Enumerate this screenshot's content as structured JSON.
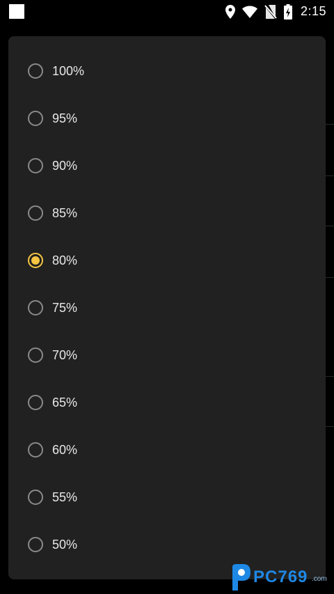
{
  "status_bar": {
    "time": "2:15",
    "icons": [
      "location-icon",
      "wifi-icon",
      "no-sim-icon",
      "battery-charging-icon"
    ]
  },
  "dialog": {
    "selected": "80%",
    "options": [
      "100%",
      "95%",
      "90%",
      "85%",
      "80%",
      "75%",
      "70%",
      "65%",
      "60%",
      "55%",
      "50%"
    ]
  },
  "accent_color": "#f5c542",
  "watermark": {
    "text": "PC769",
    "sub": ".com"
  }
}
